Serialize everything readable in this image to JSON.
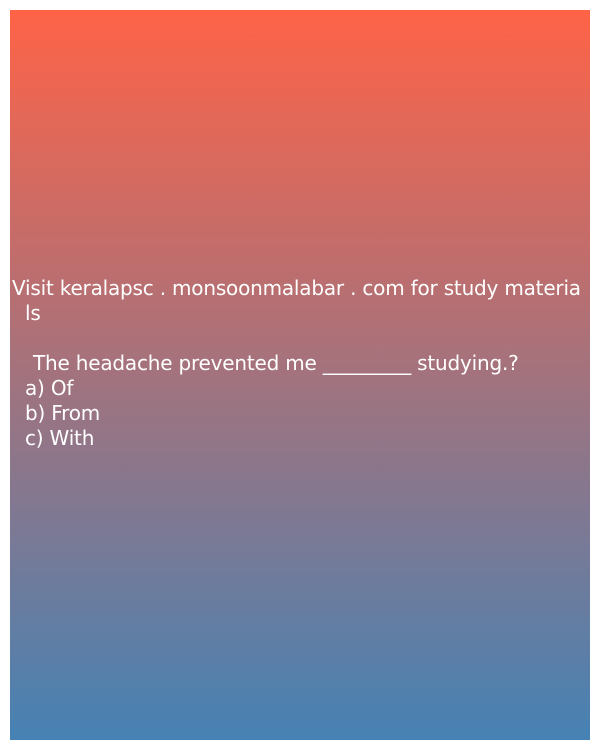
{
  "colors": {
    "gradient_top": "#FF6347",
    "gradient_bottom": "#4682B4",
    "text": "#FFFFFF"
  },
  "header": {
    "line1": "Visit keralapsc . monsoonmalabar . com for study materia",
    "line2": "ls"
  },
  "question": {
    "text": "The headache prevented me _________ studying.?",
    "options": [
      "a) Of",
      "b) From",
      "c) With"
    ]
  }
}
